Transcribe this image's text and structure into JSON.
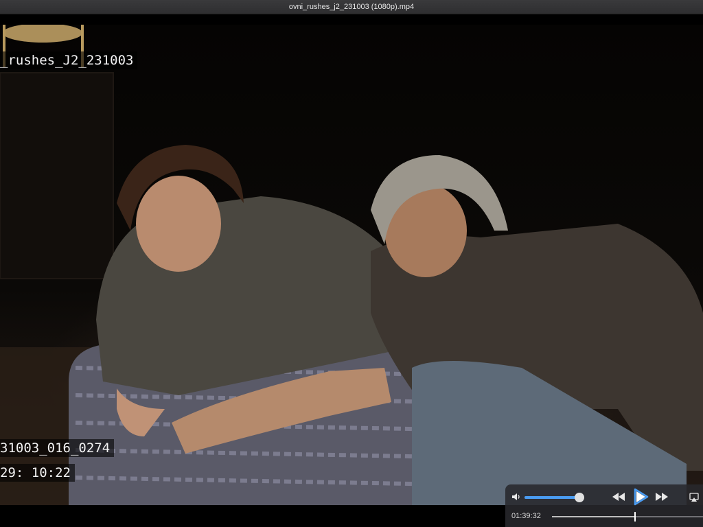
{
  "window": {
    "title": "ovni_rushes_j2_231003 (1080p).mp4"
  },
  "video": {
    "overlays": {
      "reel_name": "_rushes_J2_231003",
      "clip_id": "31003_016_0274",
      "timecode": "29: 10:22"
    }
  },
  "player": {
    "volume_level": 0.97,
    "elapsed_time": "01:39:32",
    "playback_progress": 0.52,
    "icons": {
      "volume": "speaker-icon",
      "rewind": "rewind-icon",
      "play": "play-icon",
      "fast_forward": "fast-forward-icon",
      "airplay": "airplay-icon"
    },
    "accent_color": "#4a9cf2"
  }
}
